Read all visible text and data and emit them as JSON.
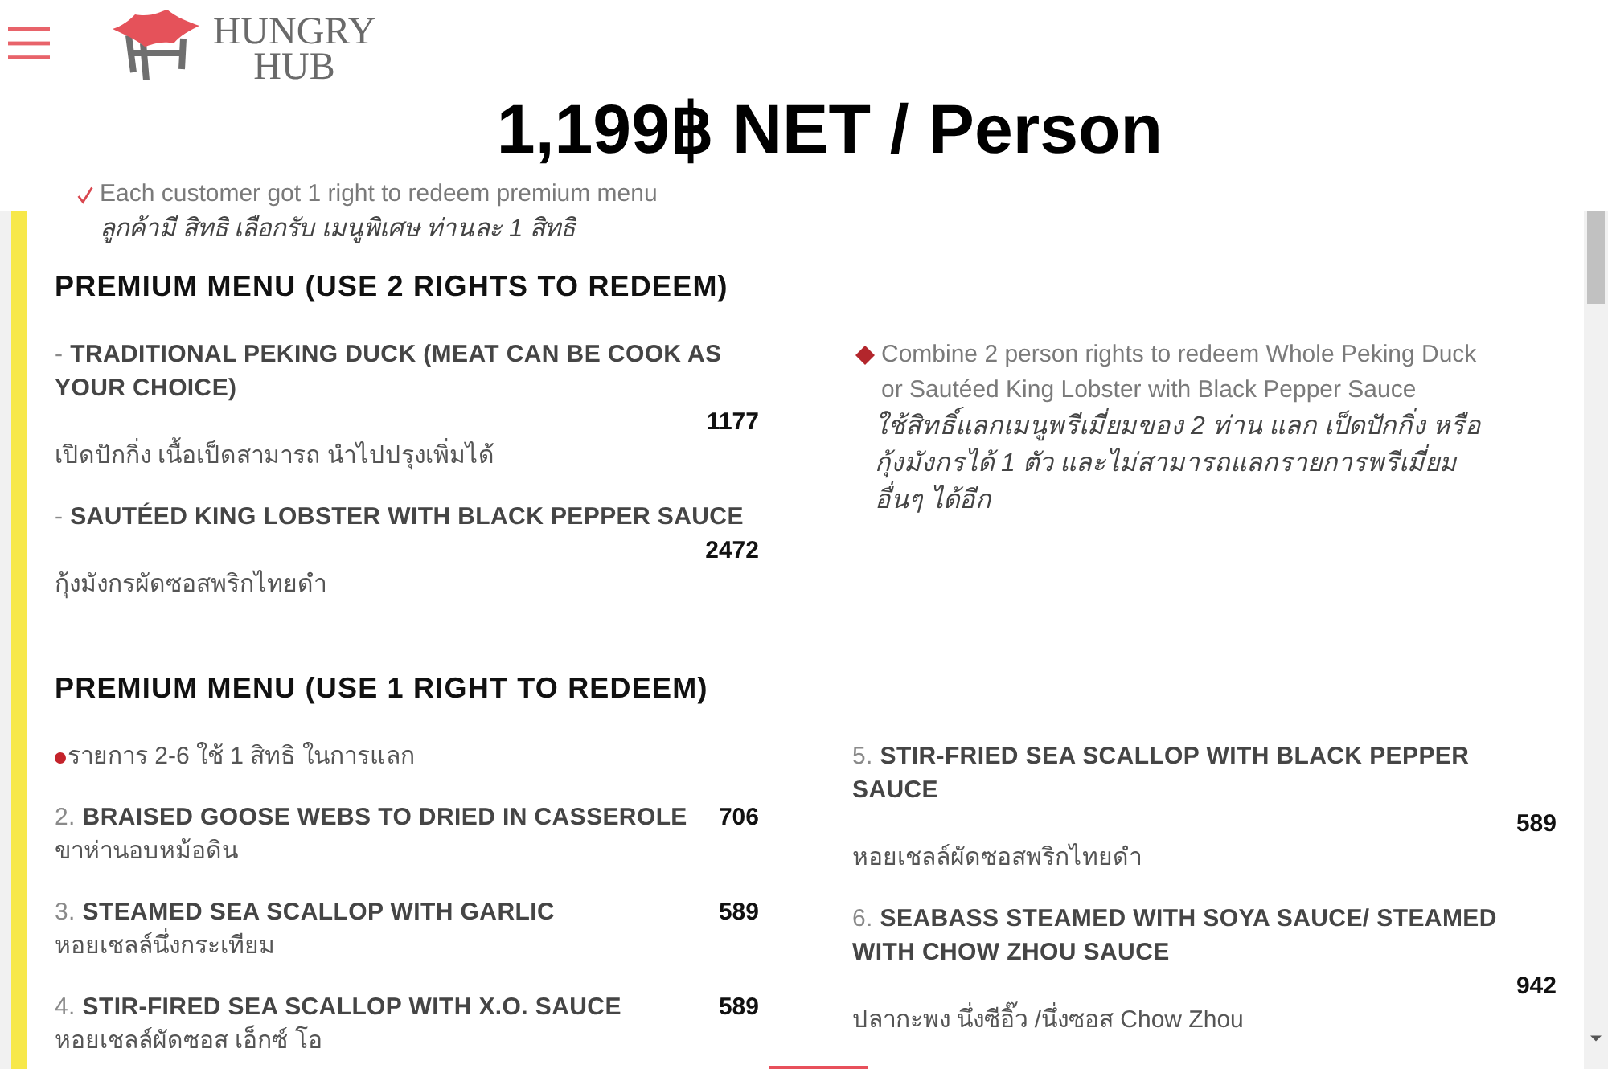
{
  "header": {
    "logo": {
      "text": "HUNGRY HUB"
    }
  },
  "title": "1,199฿ NET / Person",
  "note": {
    "text": "Each customer got 1 right to redeem premium menu",
    "thai": "ลูกค้ามี สิทธิ เลือกรับ เมนูพิเศษ ท่านละ 1 สิทธิ"
  },
  "sections": [
    {
      "heading": "PREMIUM MENU (USE 2 RIGHTS TO REDEEM)",
      "columns": [
        [
          {
            "kind": "item",
            "name": "- **TRADITIONAL PEKING DUCK (MEAT CAN BE COOK AS YOUR CHOICE)**",
            "price": "1177",
            "thai": "เปิดปักกิ่ง เนื้อเป็ดสามารถ นำไปปรุงเพิ่มได้"
          },
          {
            "kind": "item",
            "name": "- **SAUTÉED KING LOBSTER WITH BLACK PEPPER SAUCE**",
            "price": "2472",
            "thai": "กุ้งมังกรผัดซอสพริกไทยดำ"
          }
        ],
        [
          {
            "kind": "note",
            "text": "Combine 2 person rights to redeem Whole Peking Duck or Sautéed King Lobster with Black Pepper Sauce",
            "thai": "ใช้สิทธิ์แลกเมนูพรีเมี่ยมของ 2 ท่าน แลก เป็ดปักกิ่ง หรือ กุ้งมังกรได้ 1 ตัว และไม่สามารถแลกรายการพรีเมี่ยมอื่นๆ ได้อีก"
          }
        ]
      ]
    },
    {
      "heading": "PREMIUM MENU (USE 1 RIGHT TO REDEEM)",
      "columns": [
        [
          {
            "kind": "bullet",
            "text": "รายการ 2-6 ใช้ 1 สิทธิ ในการแลก"
          },
          {
            "kind": "item",
            "name": "2. **BRAISED GOOSE WEBS TO DRIED IN CASSEROLE**",
            "price": "706",
            "thai": "ขาห่านอบหม้อดิน"
          },
          {
            "kind": "item",
            "name": "3. **STEAMED SEA SCALLOP WITH GARLIC**",
            "price": "589",
            "thai": "หอยเชลล์นึ่งกระเทียม"
          },
          {
            "kind": "item",
            "name": "4. **STIR-FIRED SEA SCALLOP WITH X.O. SAUCE**",
            "price": "589",
            "thai": "หอยเชลล์ผัดซอส เอ็กซ์ โอ"
          }
        ],
        [
          {
            "kind": "item",
            "name": "5. **STIR-FRIED SEA SCALLOP WITH BLACK PEPPER SAUCE**",
            "price": "589",
            "thai": "หอยเชลล์ผัดซอสพริกไทยดำ"
          },
          {
            "kind": "item",
            "name": "6. **SEABASS STEAMED WITH SOYA SAUCE/ STEAMED WITH CHOW ZHOU SAUCE**",
            "price": "942",
            "thai": "ปลากะพง นึ่งซีอิ๊ว /นึ่งซอส Chow Zhou"
          }
        ]
      ]
    }
  ]
}
